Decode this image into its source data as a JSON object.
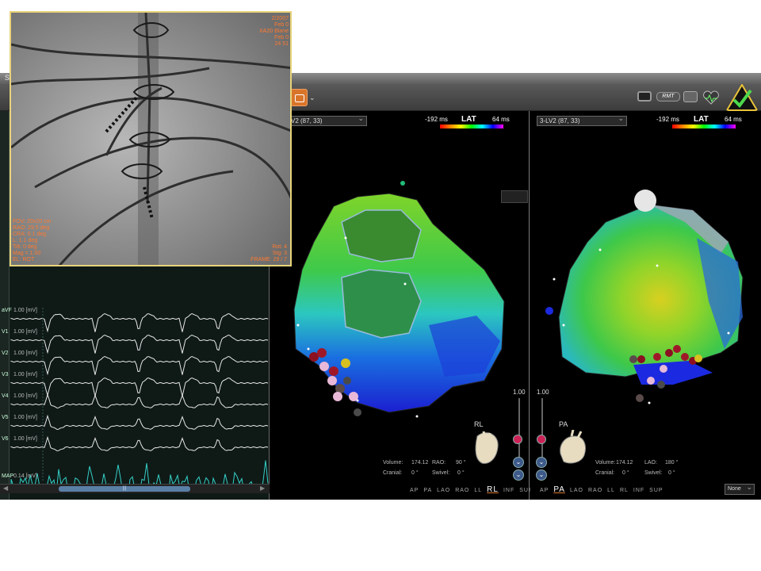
{
  "window": {
    "title": "S"
  },
  "toolbar": {
    "dropdown_arrow": "⌄"
  },
  "ecg": {
    "leads": [
      {
        "name": "aVF",
        "scale": "1.00  [mV]"
      },
      {
        "name": "V1",
        "scale": "1.00  [mV]"
      },
      {
        "name": "V2",
        "scale": "1.00  [mV]"
      },
      {
        "name": "V3",
        "scale": "1.00  [mV]"
      },
      {
        "name": "V4",
        "scale": "1.00  [mV]"
      },
      {
        "name": "V5",
        "scale": "1.00  [mV]"
      },
      {
        "name": "V6",
        "scale": "1.00  [mV]"
      },
      {
        "name": "MAP",
        "scale": "0.14  [mV]"
      }
    ],
    "scroll_thumb_label": "|||"
  },
  "map_left": {
    "view_select": "V2 (87, 33)",
    "lat_min": "-192 ms",
    "lat_title": "LAT",
    "lat_max": "64 ms",
    "zoom": "1.00",
    "volume_label": "Volume:",
    "volume_value": "174.12",
    "angle1_label": "RAO:",
    "angle1_value": "90 °",
    "cranial_label": "Cranial:",
    "cranial_value": "0 °",
    "swivel_label": "Swivel:",
    "swivel_value": "0 °",
    "orientation": "RL",
    "views": [
      "AP",
      "PA",
      "LAO",
      "RAO",
      "LL",
      "RL",
      "INF",
      "SUP"
    ],
    "current_view": "RL"
  },
  "map_right": {
    "view_select": "3-LV2 (87, 33)",
    "lat_min": "-192 ms",
    "lat_title": "LAT",
    "lat_max": "64 ms",
    "zoom": "1.00",
    "volume_label": "Volume:",
    "volume_value": "174.12",
    "angle1_label": "LAO:",
    "angle1_value": "180 °",
    "cranial_label": "Cranial:",
    "cranial_value": "0 °",
    "swivel_label": "Swivel:",
    "swivel_value": "0 °",
    "orientation": "PA",
    "views": [
      "AP",
      "PA",
      "LAO",
      "RAO",
      "LL",
      "RL",
      "INF",
      "SUP"
    ],
    "current_view": "PA",
    "display_select": "None"
  },
  "fluoro": {
    "top_right": [
      "2/2007",
      "Feb 0",
      "XA20 Blane",
      "Feb 0",
      "24 51"
    ],
    "bottom_left": [
      "FOV: 20x20 cm",
      "RAO: 29.5 deg",
      "CRA: 0.1 deg",
      "L: 1.1 deg",
      "Tilt: 0 deg",
      "Mag = 1.00",
      "EL: ROT"
    ],
    "bottom_right": [
      "Rot: 4",
      "Stg: 3",
      "FRAME: 29 / 7"
    ]
  },
  "toolbar_icons": {
    "rmt_label": "RMT"
  }
}
